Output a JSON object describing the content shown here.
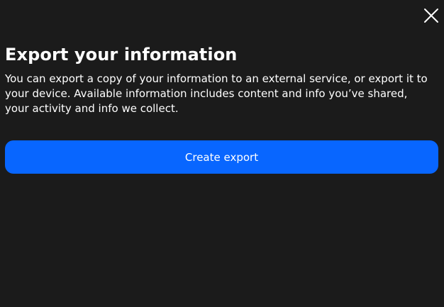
{
  "header": {
    "close_icon": "close-icon"
  },
  "main": {
    "title": "Export your information",
    "description": "You can export a copy of your information to an external service, or export it to your device. Available information includes content and info you’ve shared, your activity and info we collect.",
    "create_export_label": "Create export"
  },
  "colors": {
    "background": "#1b1b1b",
    "text": "#ffffff",
    "accent": "#0866ff"
  }
}
